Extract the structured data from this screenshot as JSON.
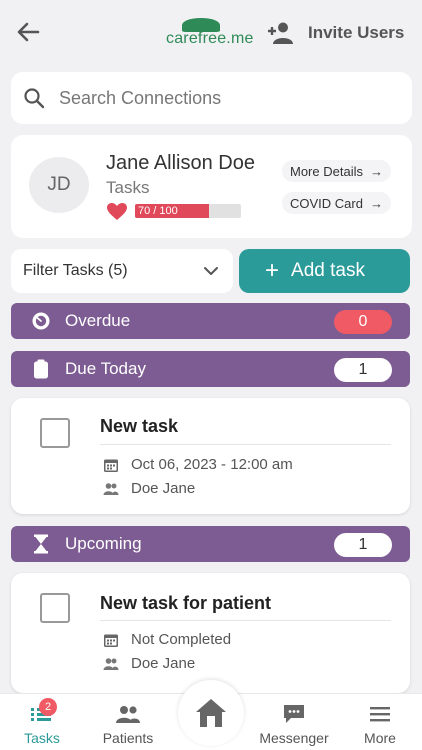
{
  "header": {
    "logo_text_main": "carefree",
    "logo_text_suffix": ".me",
    "invite_label": "Invite Users"
  },
  "search": {
    "placeholder": "Search Connections"
  },
  "profile": {
    "initials": "JD",
    "name": "Jane Allison Doe",
    "subtitle": "Tasks",
    "score_label": "70 / 100",
    "score_fraction": 0.7,
    "more_details_label": "More Details",
    "covid_label": "COVID Card"
  },
  "filter": {
    "label": "Filter Tasks (5)"
  },
  "add_task": {
    "label": "Add task"
  },
  "sections": {
    "overdue": {
      "label": "Overdue",
      "count": "0"
    },
    "due_today": {
      "label": "Due Today",
      "count": "1"
    },
    "upcoming": {
      "label": "Upcoming",
      "count": "1"
    }
  },
  "tasks": {
    "today": {
      "title": "New task",
      "date": "Oct 06, 2023 - 12:00 am",
      "assignee": "Doe Jane"
    },
    "upcoming": {
      "title": "New task for patient",
      "date": "Not Completed",
      "assignee": "Doe Jane"
    }
  },
  "tabbar": {
    "tasks_label": "Tasks",
    "tasks_badge": "2",
    "patients_label": "Patients",
    "messenger_label": "Messenger",
    "more_label": "More"
  },
  "colors": {
    "accent": "#2b9b99",
    "section_bg": "#7d5c93",
    "alert_red": "#f05a64",
    "brand_green": "#2e8b57"
  },
  "icons": {
    "back": "arrow-left-icon",
    "invite": "add-user-icon",
    "search": "search-icon",
    "heart": "heart-icon",
    "overdue": "stopwatch-icon",
    "due_today": "clipboard-icon",
    "upcoming": "hourglass-icon",
    "calendar": "calendar-icon",
    "people": "people-icon",
    "home": "home-icon",
    "messenger": "chat-icon",
    "more": "menu-icon"
  }
}
